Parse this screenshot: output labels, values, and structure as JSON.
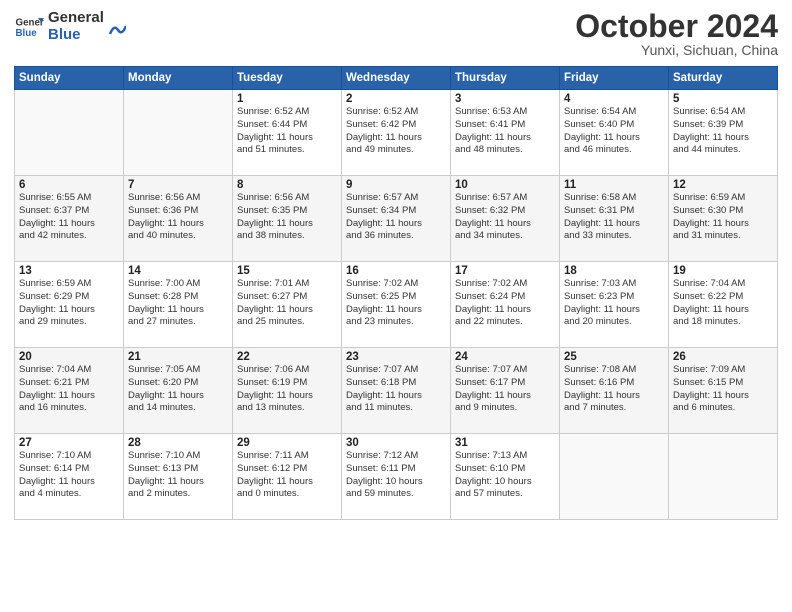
{
  "header": {
    "logo_line1": "General",
    "logo_line2": "Blue",
    "month": "October 2024",
    "location": "Yunxi, Sichuan, China"
  },
  "weekdays": [
    "Sunday",
    "Monday",
    "Tuesday",
    "Wednesday",
    "Thursday",
    "Friday",
    "Saturday"
  ],
  "weeks": [
    [
      {
        "day": "",
        "info": ""
      },
      {
        "day": "",
        "info": ""
      },
      {
        "day": "1",
        "info": "Sunrise: 6:52 AM\nSunset: 6:44 PM\nDaylight: 11 hours\nand 51 minutes."
      },
      {
        "day": "2",
        "info": "Sunrise: 6:52 AM\nSunset: 6:42 PM\nDaylight: 11 hours\nand 49 minutes."
      },
      {
        "day": "3",
        "info": "Sunrise: 6:53 AM\nSunset: 6:41 PM\nDaylight: 11 hours\nand 48 minutes."
      },
      {
        "day": "4",
        "info": "Sunrise: 6:54 AM\nSunset: 6:40 PM\nDaylight: 11 hours\nand 46 minutes."
      },
      {
        "day": "5",
        "info": "Sunrise: 6:54 AM\nSunset: 6:39 PM\nDaylight: 11 hours\nand 44 minutes."
      }
    ],
    [
      {
        "day": "6",
        "info": "Sunrise: 6:55 AM\nSunset: 6:37 PM\nDaylight: 11 hours\nand 42 minutes."
      },
      {
        "day": "7",
        "info": "Sunrise: 6:56 AM\nSunset: 6:36 PM\nDaylight: 11 hours\nand 40 minutes."
      },
      {
        "day": "8",
        "info": "Sunrise: 6:56 AM\nSunset: 6:35 PM\nDaylight: 11 hours\nand 38 minutes."
      },
      {
        "day": "9",
        "info": "Sunrise: 6:57 AM\nSunset: 6:34 PM\nDaylight: 11 hours\nand 36 minutes."
      },
      {
        "day": "10",
        "info": "Sunrise: 6:57 AM\nSunset: 6:32 PM\nDaylight: 11 hours\nand 34 minutes."
      },
      {
        "day": "11",
        "info": "Sunrise: 6:58 AM\nSunset: 6:31 PM\nDaylight: 11 hours\nand 33 minutes."
      },
      {
        "day": "12",
        "info": "Sunrise: 6:59 AM\nSunset: 6:30 PM\nDaylight: 11 hours\nand 31 minutes."
      }
    ],
    [
      {
        "day": "13",
        "info": "Sunrise: 6:59 AM\nSunset: 6:29 PM\nDaylight: 11 hours\nand 29 minutes."
      },
      {
        "day": "14",
        "info": "Sunrise: 7:00 AM\nSunset: 6:28 PM\nDaylight: 11 hours\nand 27 minutes."
      },
      {
        "day": "15",
        "info": "Sunrise: 7:01 AM\nSunset: 6:27 PM\nDaylight: 11 hours\nand 25 minutes."
      },
      {
        "day": "16",
        "info": "Sunrise: 7:02 AM\nSunset: 6:25 PM\nDaylight: 11 hours\nand 23 minutes."
      },
      {
        "day": "17",
        "info": "Sunrise: 7:02 AM\nSunset: 6:24 PM\nDaylight: 11 hours\nand 22 minutes."
      },
      {
        "day": "18",
        "info": "Sunrise: 7:03 AM\nSunset: 6:23 PM\nDaylight: 11 hours\nand 20 minutes."
      },
      {
        "day": "19",
        "info": "Sunrise: 7:04 AM\nSunset: 6:22 PM\nDaylight: 11 hours\nand 18 minutes."
      }
    ],
    [
      {
        "day": "20",
        "info": "Sunrise: 7:04 AM\nSunset: 6:21 PM\nDaylight: 11 hours\nand 16 minutes."
      },
      {
        "day": "21",
        "info": "Sunrise: 7:05 AM\nSunset: 6:20 PM\nDaylight: 11 hours\nand 14 minutes."
      },
      {
        "day": "22",
        "info": "Sunrise: 7:06 AM\nSunset: 6:19 PM\nDaylight: 11 hours\nand 13 minutes."
      },
      {
        "day": "23",
        "info": "Sunrise: 7:07 AM\nSunset: 6:18 PM\nDaylight: 11 hours\nand 11 minutes."
      },
      {
        "day": "24",
        "info": "Sunrise: 7:07 AM\nSunset: 6:17 PM\nDaylight: 11 hours\nand 9 minutes."
      },
      {
        "day": "25",
        "info": "Sunrise: 7:08 AM\nSunset: 6:16 PM\nDaylight: 11 hours\nand 7 minutes."
      },
      {
        "day": "26",
        "info": "Sunrise: 7:09 AM\nSunset: 6:15 PM\nDaylight: 11 hours\nand 6 minutes."
      }
    ],
    [
      {
        "day": "27",
        "info": "Sunrise: 7:10 AM\nSunset: 6:14 PM\nDaylight: 11 hours\nand 4 minutes."
      },
      {
        "day": "28",
        "info": "Sunrise: 7:10 AM\nSunset: 6:13 PM\nDaylight: 11 hours\nand 2 minutes."
      },
      {
        "day": "29",
        "info": "Sunrise: 7:11 AM\nSunset: 6:12 PM\nDaylight: 11 hours\nand 0 minutes."
      },
      {
        "day": "30",
        "info": "Sunrise: 7:12 AM\nSunset: 6:11 PM\nDaylight: 10 hours\nand 59 minutes."
      },
      {
        "day": "31",
        "info": "Sunrise: 7:13 AM\nSunset: 6:10 PM\nDaylight: 10 hours\nand 57 minutes."
      },
      {
        "day": "",
        "info": ""
      },
      {
        "day": "",
        "info": ""
      }
    ]
  ]
}
